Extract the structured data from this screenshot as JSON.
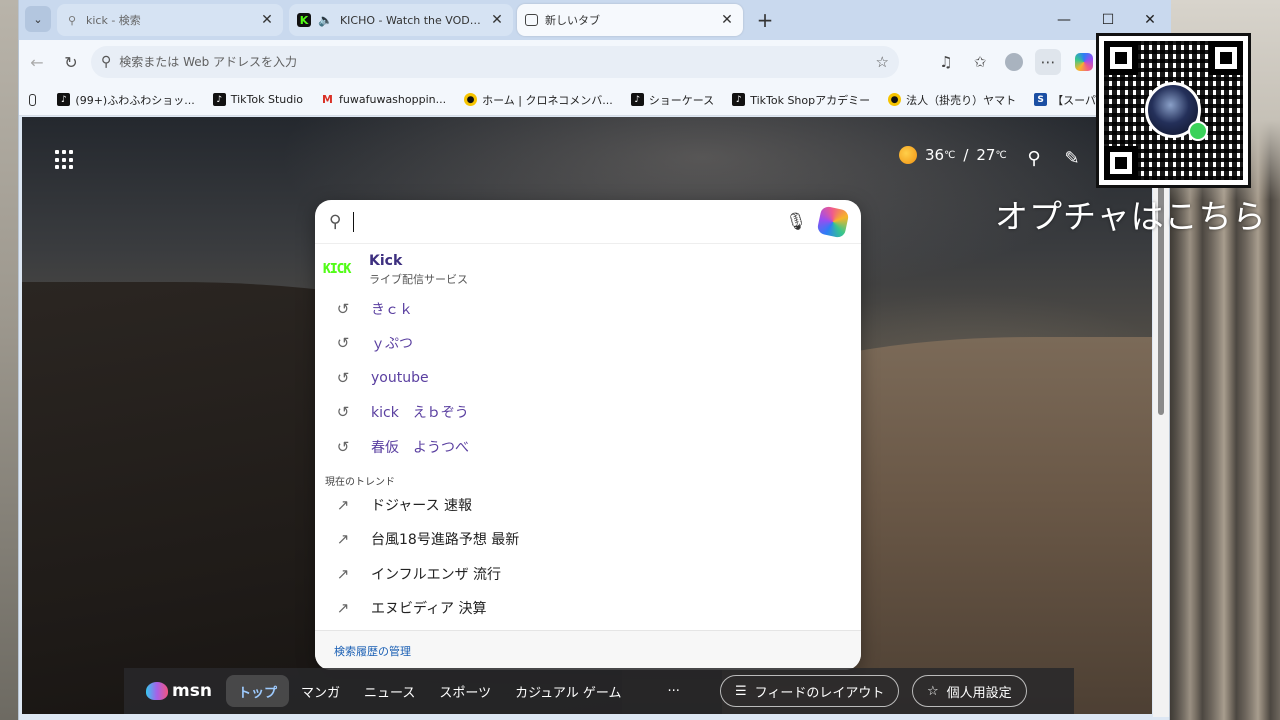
{
  "tabs": [
    {
      "title": "kick - 検索",
      "favicon": "search-icon"
    },
    {
      "title": "KICHO - Watch the VOD on K",
      "favicon": "kick-favicon",
      "audio": "speaker-icon"
    },
    {
      "title": "新しいタブ",
      "favicon": "newtab-icon"
    }
  ],
  "window_controls": {
    "minimize": "—",
    "maximize": "☐",
    "close": "✕"
  },
  "address": {
    "placeholder": "検索または Web アドレスを入力"
  },
  "bookmarks": [
    {
      "label": "(99+)ふわふわショッ...",
      "icon": "tiktok-icon"
    },
    {
      "label": "TikTok Studio",
      "icon": "tiktok-icon"
    },
    {
      "label": "fuwafuwashoppin...",
      "icon": "gmail-icon"
    },
    {
      "label": "ホーム | クロネコメンバ...",
      "icon": "yamato-icon"
    },
    {
      "label": "ショーケース",
      "icon": "tiktok-icon"
    },
    {
      "label": "TikTok Shopアカデミー",
      "icon": "tiktok-icon"
    },
    {
      "label": "法人（掛売り）ヤマト",
      "icon": "yamato-icon"
    },
    {
      "label": "【スーパーデリバリー",
      "icon": "sd-icon"
    }
  ],
  "weather": {
    "high": "36",
    "low": "27",
    "unit": "℃",
    "separator": "/"
  },
  "search": {
    "top_result": {
      "title": "Kick",
      "subtitle": "ライブ配信サービス",
      "logo_text": "KICK"
    },
    "history": [
      "きｃｋ",
      "ｙぷつ",
      "youtube",
      "kick　えｂぞう",
      "春仮　ようつべ"
    ],
    "trend_label": "現在のトレンド",
    "trends": [
      "ドジャース 速報",
      "台風18号進路予想 最新",
      "インフルエンザ 流行",
      "エヌビディア 決算"
    ],
    "manage_label": "検索履歴の管理"
  },
  "msn": {
    "logo": "msn",
    "tabs": [
      "トップ",
      "マンガ",
      "ニュース",
      "スポーツ",
      "カジュアル ゲーム"
    ],
    "more": "···",
    "feed_layout": "フィードのレイアウト",
    "personalize": "個人用設定"
  },
  "overlay": {
    "caption": "オプチャはこちら"
  }
}
